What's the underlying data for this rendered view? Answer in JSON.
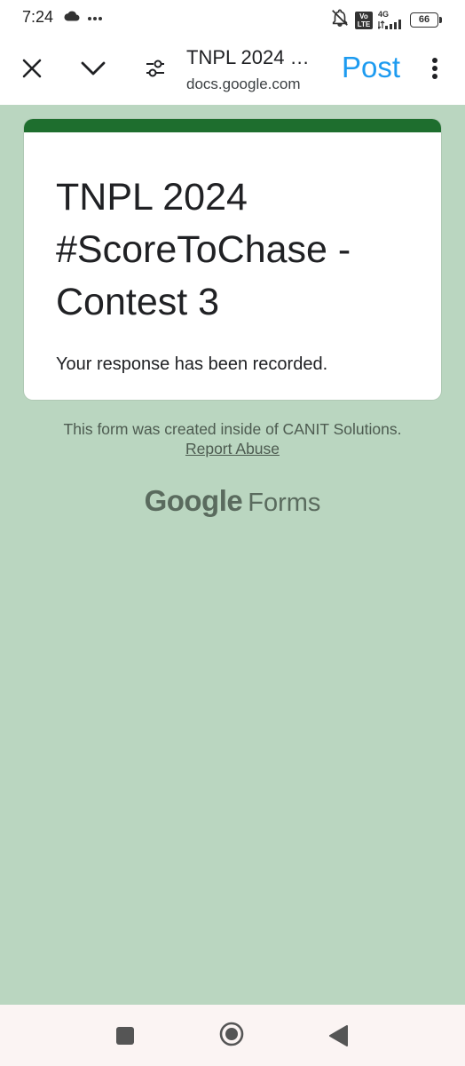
{
  "status_bar": {
    "time": "7:24",
    "left_icons": [
      "cloud-icon",
      "more-dots-icon"
    ],
    "volte": "Vo LTE",
    "network": "4G",
    "battery": "66",
    "right_icons": [
      "bell-off-icon",
      "volte-icon",
      "signal-icon",
      "battery-icon"
    ]
  },
  "browser_bar": {
    "title": "TNPL 2024 …",
    "url": "docs.google.com",
    "post_label": "Post",
    "post_color": "#1d9bf0",
    "icons": [
      "close-icon",
      "chevron-down-icon",
      "tune-icon",
      "more-vert-icon"
    ]
  },
  "form": {
    "title_lines": [
      "TNPL 2024",
      "#ScoreToChase -",
      "Contest 3"
    ],
    "message": "Your response has been recorded.",
    "accent_color": "#1e6e2e",
    "background_color": "#bad6c0"
  },
  "footer": {
    "created_text": "This form was created inside of CANIT Solutions.",
    "report_label": "Report Abuse",
    "brand_google": "Google",
    "brand_forms": "Forms"
  },
  "nav_bar": {
    "icons": [
      "recents-square-icon",
      "home-circle-icon",
      "back-triangle-icon"
    ]
  }
}
